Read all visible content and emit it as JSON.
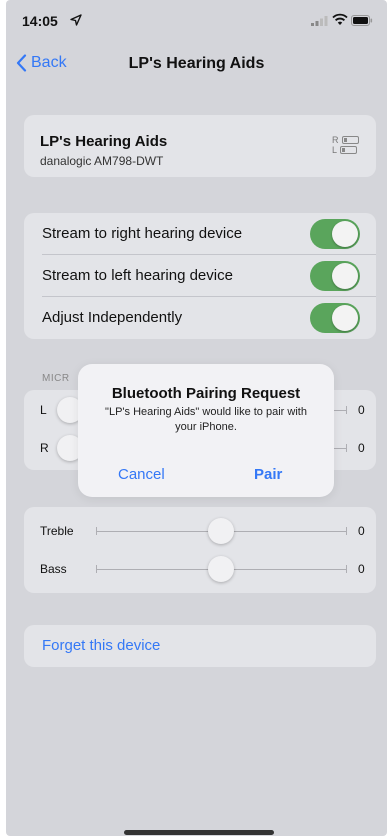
{
  "status": {
    "time": "14:05"
  },
  "nav": {
    "back_label": "Back",
    "title": "LP's Hearing Aids"
  },
  "device": {
    "name": "LP's Hearing Aids",
    "model": "danalogic AM798-DWT",
    "right_label": "R",
    "left_label": "L"
  },
  "toggles": [
    {
      "label": "Stream to right hearing device",
      "on": true
    },
    {
      "label": "Stream to left hearing device",
      "on": true
    },
    {
      "label": "Adjust Independently",
      "on": true
    }
  ],
  "microphone": {
    "header": "MICR",
    "rows": [
      {
        "label": "L",
        "value": "0"
      },
      {
        "label": "R",
        "value": "0"
      }
    ]
  },
  "tone": [
    {
      "label": "Treble",
      "value": "0",
      "level": 0.5
    },
    {
      "label": "Bass",
      "value": "0",
      "level": 0.5
    }
  ],
  "forget_label": "Forget this device",
  "dialog": {
    "title": "Bluetooth Pairing Request",
    "message": "\"LP's Hearing Aids\" would like to pair with your iPhone.",
    "cancel_label": "Cancel",
    "pair_label": "Pair"
  },
  "colors": {
    "accent": "#3478f6",
    "switch_on": "#5aa55c",
    "background": "#d4d5da"
  }
}
